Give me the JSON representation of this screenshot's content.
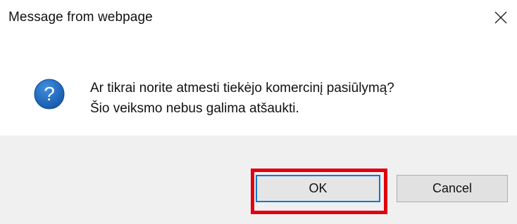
{
  "window": {
    "title": "Message from webpage",
    "close_icon": "close-icon"
  },
  "dialog": {
    "icon": "question-icon",
    "message_line1": "Ar tikrai norite atmesti tiekėjo komercinį pasiūlymą?",
    "message_line2": "Šio veiksmo nebus galima atšaukti."
  },
  "buttons": {
    "ok_label": "OK",
    "cancel_label": "Cancel"
  },
  "colors": {
    "footer_bg": "#f0f0f0",
    "focus_border": "#0078d7",
    "highlight": "#e0000f",
    "icon_blue": "#1e66b3"
  }
}
